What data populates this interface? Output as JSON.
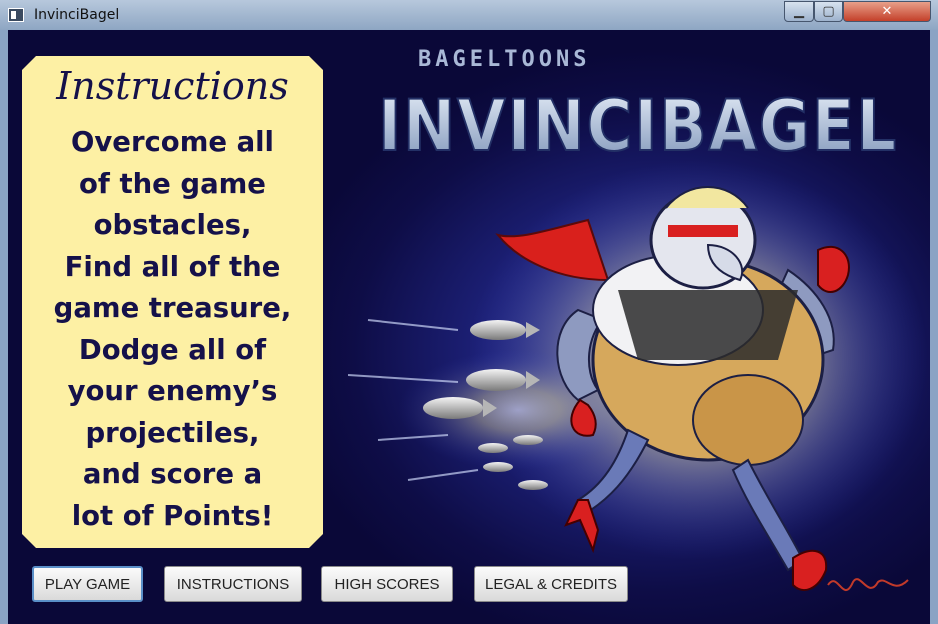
{
  "window": {
    "title": "InvinciBagel",
    "controls": {
      "minimize": "▁",
      "maximize": "▢",
      "close": "✕"
    }
  },
  "instructions": {
    "title": "Instructions",
    "text": "Overcome all\nof the game\nobstacles,\nFind all of the\ngame treasure,\nDodge all of\nyour enemy’s\nprojectiles,\nand score a\nlot of Points!"
  },
  "artwork": {
    "studio": "BAGELTOONS",
    "logo": "INVINCIBAGEL"
  },
  "buttons": {
    "play": "PLAY GAME",
    "instructions": "INSTRUCTIONS",
    "high_scores": "HIGH SCORES",
    "legal": "LEGAL & CREDITS"
  },
  "colors": {
    "background": "#13105a",
    "panel": "#fdf0a4",
    "panel_text": "#15114a",
    "hero_cape": "#d9201c"
  }
}
